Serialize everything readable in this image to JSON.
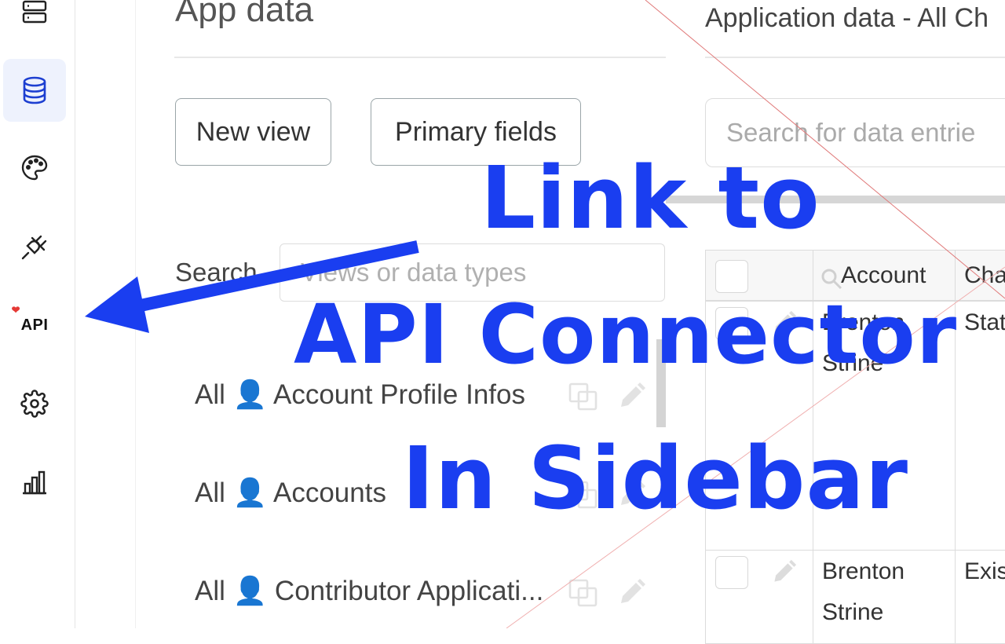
{
  "sidebar": {
    "items": [
      {
        "icon": "server-icon"
      },
      {
        "icon": "database-icon",
        "active": true
      },
      {
        "icon": "palette-icon"
      },
      {
        "icon": "plug-icon"
      },
      {
        "label": "API",
        "badge_icon": "heart-icon"
      },
      {
        "icon": "gear-icon"
      },
      {
        "icon": "bar-chart-icon"
      }
    ]
  },
  "main": {
    "title": "App data",
    "new_view_label": "New view",
    "primary_fields_label": "Primary fields",
    "search_label": "Search",
    "search_placeholder": "Views or data types",
    "list": [
      {
        "label": "All 👤 Account Profile Infos"
      },
      {
        "label": "All 👤 Accounts"
      },
      {
        "label": "All 👤 Contributor Applicati..."
      }
    ]
  },
  "right": {
    "title": "Application data - All Ch",
    "search_placeholder": "Search for data entrie",
    "columns": [
      "Account",
      "Cha"
    ],
    "rows": [
      {
        "account": "Brenton Strine",
        "status": "Stat"
      },
      {
        "account": "Brenton Strine",
        "status": "Exis"
      }
    ]
  },
  "overlay": {
    "line1": "Link to",
    "line2": "API Connector",
    "line3": "In Sidebar",
    "color": "#1a3ef0"
  }
}
